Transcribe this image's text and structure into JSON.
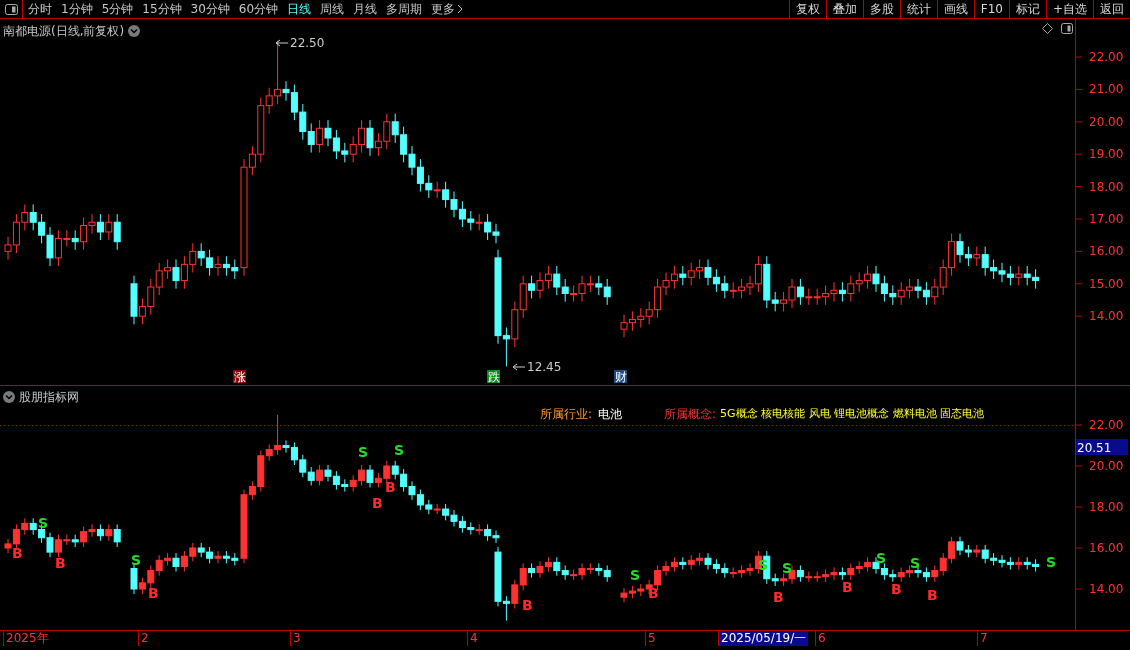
{
  "toolbar": {
    "periods": [
      {
        "label": "分时",
        "selected": false
      },
      {
        "label": "1分钟",
        "selected": false
      },
      {
        "label": "5分钟",
        "selected": false
      },
      {
        "label": "15分钟",
        "selected": false
      },
      {
        "label": "30分钟",
        "selected": false
      },
      {
        "label": "60分钟",
        "selected": false
      },
      {
        "label": "日线",
        "selected": true
      },
      {
        "label": "周线",
        "selected": false
      },
      {
        "label": "月线",
        "selected": false
      },
      {
        "label": "多周期",
        "selected": false
      },
      {
        "label": "更多",
        "selected": false
      }
    ],
    "actions": [
      "复权",
      "叠加",
      "多股",
      "统计",
      "画线",
      "F10",
      "标记",
      "+自选",
      "返回"
    ]
  },
  "price_chart": {
    "title": "南都电源(日线,前复权)",
    "y_axis": [
      "22.00",
      "21.00",
      "20.00",
      "19.00",
      "18.00",
      "17.00",
      "16.00",
      "15.00",
      "14.00"
    ],
    "high_label": "22.50",
    "low_label": "12.45",
    "events": [
      {
        "label": "涨",
        "color": "#8b0a0a"
      },
      {
        "label": "跌",
        "color": "#0a8a1a"
      },
      {
        "label": "财",
        "color": "#1a4a80"
      }
    ]
  },
  "indicator": {
    "title": "股朋指标网",
    "industry_label": "所属行业:",
    "industry": "电池",
    "concept_label": "所属概念:",
    "concepts": "5G概念 核电核能 风电 锂电池概念 燃料电池 固态电池",
    "y_axis": [
      "22.00",
      "20.00",
      "18.00",
      "16.00",
      "14.00"
    ],
    "current_price": "20.51",
    "signals": [
      {
        "label": "B",
        "kind": "buy"
      },
      {
        "label": "S",
        "kind": "sell"
      },
      {
        "label": "B",
        "kind": "buy"
      },
      {
        "label": "S",
        "kind": "sell"
      },
      {
        "label": "B",
        "kind": "buy"
      },
      {
        "label": "S",
        "kind": "sell"
      },
      {
        "label": "B",
        "kind": "buy"
      },
      {
        "label": "B",
        "kind": "buy"
      },
      {
        "label": "S",
        "kind": "sell"
      },
      {
        "label": "B",
        "kind": "buy"
      },
      {
        "label": "S",
        "kind": "sell"
      },
      {
        "label": "B",
        "kind": "buy"
      },
      {
        "label": "S",
        "kind": "sell"
      },
      {
        "label": "B",
        "kind": "buy"
      },
      {
        "label": "S",
        "kind": "sell"
      },
      {
        "label": "B",
        "kind": "buy"
      },
      {
        "label": "S",
        "kind": "sell"
      },
      {
        "label": "B",
        "kind": "buy"
      },
      {
        "label": "S",
        "kind": "sell"
      },
      {
        "label": "B",
        "kind": "buy"
      },
      {
        "label": "S",
        "kind": "sell"
      }
    ]
  },
  "time_axis": [
    {
      "label": "2025年",
      "selected": false
    },
    {
      "label": "2",
      "selected": false
    },
    {
      "label": "3",
      "selected": false
    },
    {
      "label": "4",
      "selected": false
    },
    {
      "label": "5",
      "selected": false
    },
    {
      "label": "2025/05/19/一",
      "selected": true
    },
    {
      "label": "6",
      "selected": false
    },
    {
      "label": "7",
      "selected": false
    }
  ]
}
